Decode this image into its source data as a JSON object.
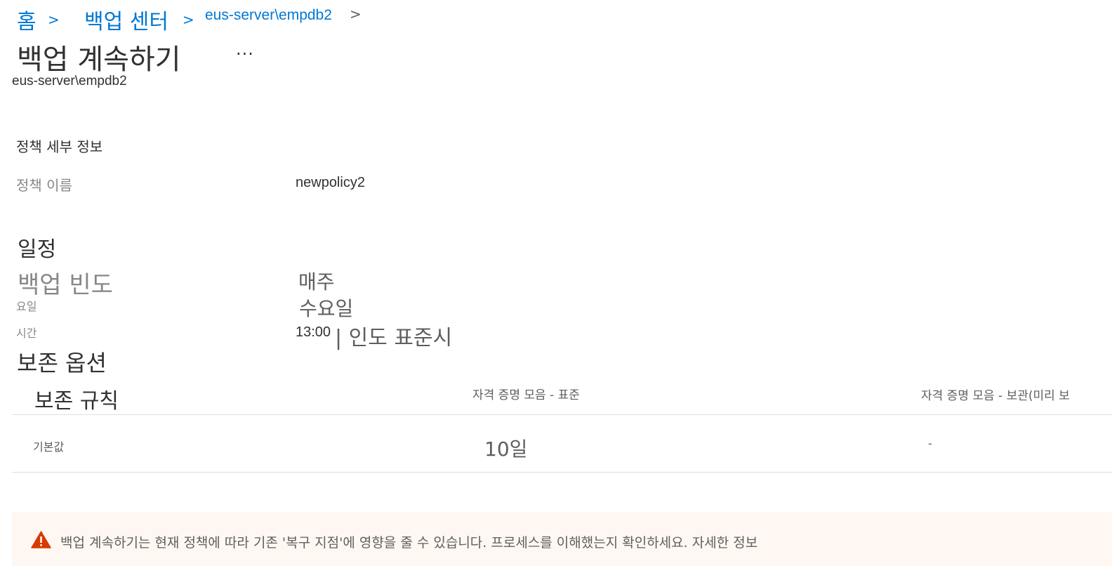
{
  "breadcrumb": {
    "home": "홈",
    "separator": ">",
    "backup_center": "백업 센터",
    "server": "eus-server\\empdb2",
    "trailing_chevron": ">"
  },
  "header": {
    "title": "백업 계속하기",
    "more": "...",
    "subtitle": "eus-server\\empdb2"
  },
  "policy_details": {
    "section_title": "정책 세부 정보",
    "policy_name_label": "정책 이름",
    "policy_name_value": "newpolicy2"
  },
  "schedule": {
    "section_title": "일정",
    "frequency_label": "백업 빈도",
    "frequency_value": "매주",
    "day_label": "요일",
    "day_value": "수요일",
    "time_label": "시간",
    "time_value": "13:00",
    "timezone_value": "| 인도 표준시"
  },
  "retention": {
    "section_title": "보존 옵션",
    "columns": [
      "보존 규칙",
      "자격 증명 모음 - 표준",
      "자격 증명 모음 - 보관(미리 보"
    ],
    "rows": [
      [
        "기본값",
        "10일",
        "-"
      ]
    ]
  },
  "warning": {
    "icon": "warning-triangle-icon",
    "text": "백업 계속하기는 현재 정책에 따라 기존 '복구 지점'에 영향을 줄 수 있습니다. 프로세스를 이해했는지 확인하세요.",
    "link": "자세한 정보"
  },
  "colors": {
    "link": "#0078d4",
    "warning_bg": "#fff8f2",
    "warning_icon": "#d83b01"
  }
}
